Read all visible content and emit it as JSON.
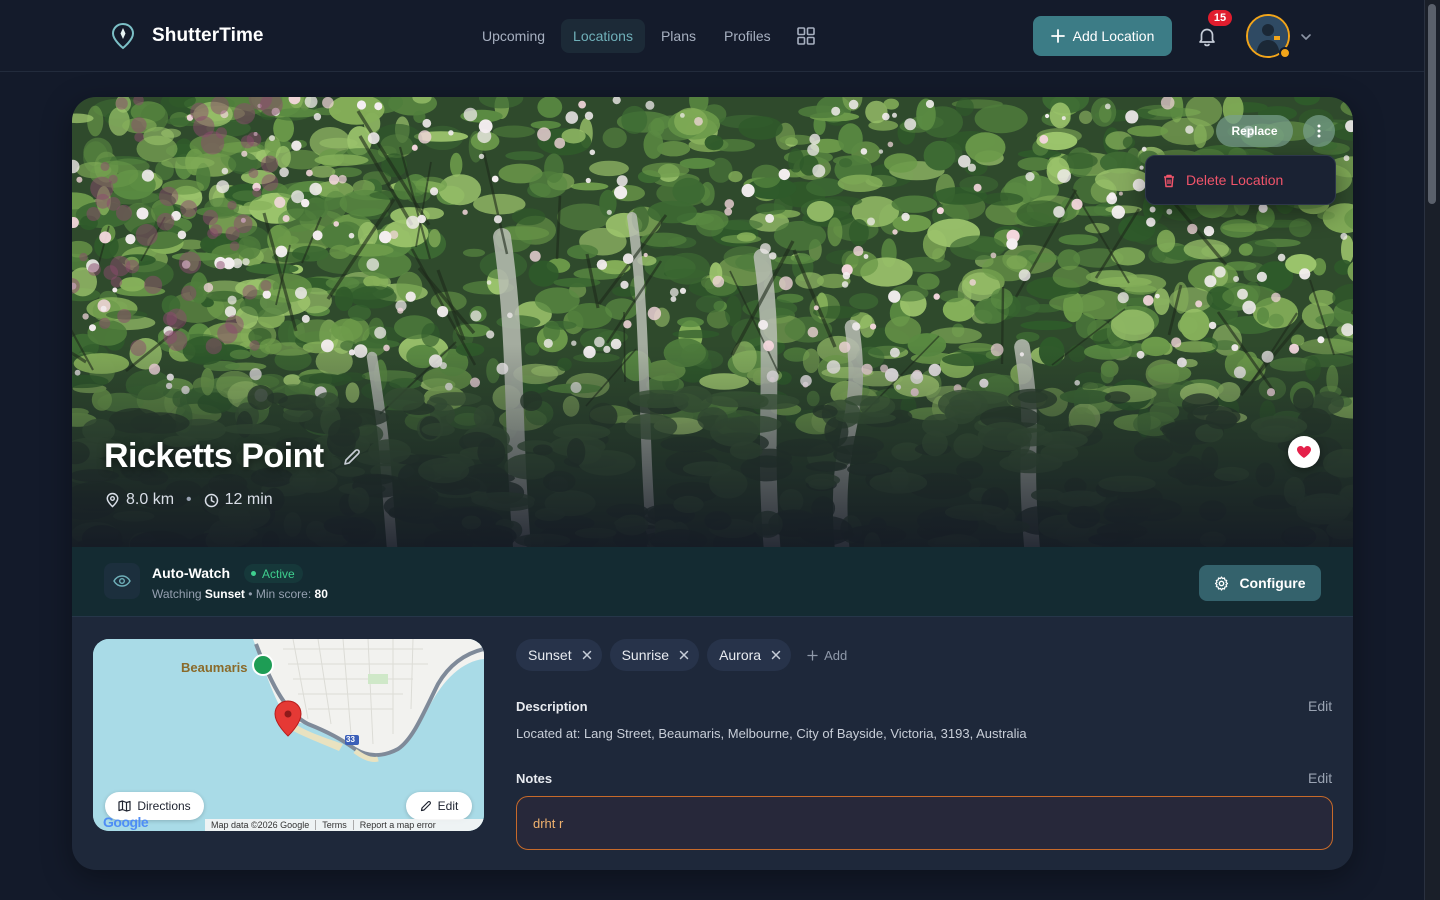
{
  "header": {
    "brand": "ShutterTime",
    "nav": [
      {
        "label": "Upcoming",
        "active": false
      },
      {
        "label": "Locations",
        "active": true
      },
      {
        "label": "Plans",
        "active": false
      },
      {
        "label": "Profiles",
        "active": false
      }
    ],
    "add_button": "Add Location",
    "notifications_count": "15",
    "accent_color": "#3c7c86"
  },
  "location": {
    "name": "Ricketts Point",
    "distance": "8.0 km",
    "drive_time": "12 min",
    "favorite": true
  },
  "hero_actions": {
    "replace": "Replace",
    "menu": {
      "delete": "Delete Location"
    }
  },
  "auto_watch": {
    "title": "Auto-Watch",
    "status": "Active",
    "watching_prefix": "Watching",
    "watching_event": "Sunset",
    "min_score_label": "• Min score:",
    "min_score": "80",
    "configure": "Configure"
  },
  "map": {
    "place_label": "Beaumaris",
    "road_shield": "33",
    "directions": "Directions",
    "edit": "Edit",
    "attribution": [
      "Map data ©2026 Google",
      "Terms",
      "Report a map error"
    ],
    "logo": "Google"
  },
  "tags": {
    "items": [
      "Sunset",
      "Sunrise",
      "Aurora"
    ],
    "add": "Add"
  },
  "description": {
    "label": "Description",
    "edit": "Edit",
    "text": "Located at: Lang Street, Beaumaris, Melbourne, City of Bayside, Victoria, 3193, Australia"
  },
  "notes": {
    "label": "Notes",
    "edit": "Edit",
    "value": "drht r"
  },
  "icons": {
    "brand": "location-pin-icon",
    "apps": "grid-icon",
    "plus": "plus-icon",
    "bell": "bell-icon",
    "chevron": "chevron-down-icon",
    "more": "more-vertical-icon",
    "trash": "trash-icon",
    "pencil": "pencil-icon",
    "pin": "map-pin-icon",
    "clock": "clock-icon",
    "heart": "heart-icon",
    "eye": "eye-icon",
    "gear": "gear-icon",
    "map": "map-icon",
    "close": "close-icon"
  }
}
